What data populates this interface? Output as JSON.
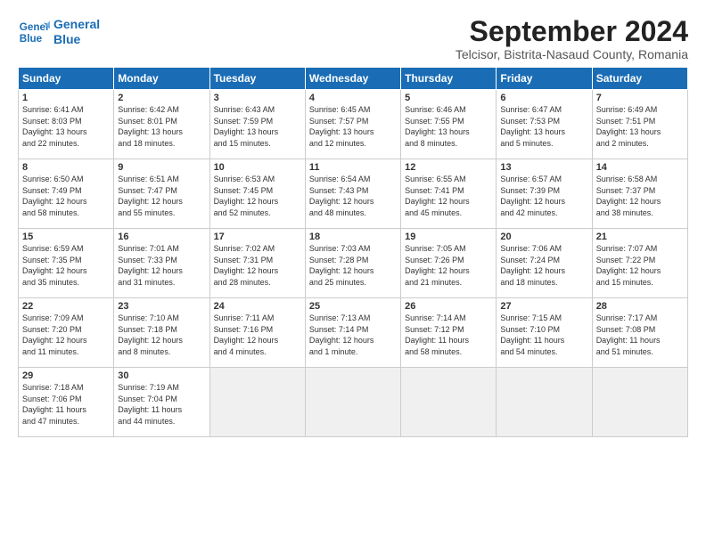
{
  "header": {
    "logo_line1": "General",
    "logo_line2": "Blue",
    "title": "September 2024",
    "subtitle": "Telcisor, Bistrita-Nasaud County, Romania"
  },
  "calendar": {
    "headers": [
      "Sunday",
      "Monday",
      "Tuesday",
      "Wednesday",
      "Thursday",
      "Friday",
      "Saturday"
    ],
    "weeks": [
      [
        {
          "day": "",
          "empty": true
        },
        {
          "day": "",
          "empty": true
        },
        {
          "day": "",
          "empty": true
        },
        {
          "day": "",
          "empty": true
        },
        {
          "day": "",
          "empty": true
        },
        {
          "day": "",
          "empty": true
        },
        {
          "day": "",
          "empty": true
        }
      ],
      [
        {
          "day": "1",
          "rise": "Sunrise: 6:41 AM",
          "set": "Sunset: 8:03 PM",
          "light": "Daylight: 13 hours",
          "light2": "and 22 minutes."
        },
        {
          "day": "2",
          "rise": "Sunrise: 6:42 AM",
          "set": "Sunset: 8:01 PM",
          "light": "Daylight: 13 hours",
          "light2": "and 18 minutes."
        },
        {
          "day": "3",
          "rise": "Sunrise: 6:43 AM",
          "set": "Sunset: 7:59 PM",
          "light": "Daylight: 13 hours",
          "light2": "and 15 minutes."
        },
        {
          "day": "4",
          "rise": "Sunrise: 6:45 AM",
          "set": "Sunset: 7:57 PM",
          "light": "Daylight: 13 hours",
          "light2": "and 12 minutes."
        },
        {
          "day": "5",
          "rise": "Sunrise: 6:46 AM",
          "set": "Sunset: 7:55 PM",
          "light": "Daylight: 13 hours",
          "light2": "and 8 minutes."
        },
        {
          "day": "6",
          "rise": "Sunrise: 6:47 AM",
          "set": "Sunset: 7:53 PM",
          "light": "Daylight: 13 hours",
          "light2": "and 5 minutes."
        },
        {
          "day": "7",
          "rise": "Sunrise: 6:49 AM",
          "set": "Sunset: 7:51 PM",
          "light": "Daylight: 13 hours",
          "light2": "and 2 minutes."
        }
      ],
      [
        {
          "day": "8",
          "rise": "Sunrise: 6:50 AM",
          "set": "Sunset: 7:49 PM",
          "light": "Daylight: 12 hours",
          "light2": "and 58 minutes."
        },
        {
          "day": "9",
          "rise": "Sunrise: 6:51 AM",
          "set": "Sunset: 7:47 PM",
          "light": "Daylight: 12 hours",
          "light2": "and 55 minutes."
        },
        {
          "day": "10",
          "rise": "Sunrise: 6:53 AM",
          "set": "Sunset: 7:45 PM",
          "light": "Daylight: 12 hours",
          "light2": "and 52 minutes."
        },
        {
          "day": "11",
          "rise": "Sunrise: 6:54 AM",
          "set": "Sunset: 7:43 PM",
          "light": "Daylight: 12 hours",
          "light2": "and 48 minutes."
        },
        {
          "day": "12",
          "rise": "Sunrise: 6:55 AM",
          "set": "Sunset: 7:41 PM",
          "light": "Daylight: 12 hours",
          "light2": "and 45 minutes."
        },
        {
          "day": "13",
          "rise": "Sunrise: 6:57 AM",
          "set": "Sunset: 7:39 PM",
          "light": "Daylight: 12 hours",
          "light2": "and 42 minutes."
        },
        {
          "day": "14",
          "rise": "Sunrise: 6:58 AM",
          "set": "Sunset: 7:37 PM",
          "light": "Daylight: 12 hours",
          "light2": "and 38 minutes."
        }
      ],
      [
        {
          "day": "15",
          "rise": "Sunrise: 6:59 AM",
          "set": "Sunset: 7:35 PM",
          "light": "Daylight: 12 hours",
          "light2": "and 35 minutes."
        },
        {
          "day": "16",
          "rise": "Sunrise: 7:01 AM",
          "set": "Sunset: 7:33 PM",
          "light": "Daylight: 12 hours",
          "light2": "and 31 minutes."
        },
        {
          "day": "17",
          "rise": "Sunrise: 7:02 AM",
          "set": "Sunset: 7:31 PM",
          "light": "Daylight: 12 hours",
          "light2": "and 28 minutes."
        },
        {
          "day": "18",
          "rise": "Sunrise: 7:03 AM",
          "set": "Sunset: 7:28 PM",
          "light": "Daylight: 12 hours",
          "light2": "and 25 minutes."
        },
        {
          "day": "19",
          "rise": "Sunrise: 7:05 AM",
          "set": "Sunset: 7:26 PM",
          "light": "Daylight: 12 hours",
          "light2": "and 21 minutes."
        },
        {
          "day": "20",
          "rise": "Sunrise: 7:06 AM",
          "set": "Sunset: 7:24 PM",
          "light": "Daylight: 12 hours",
          "light2": "and 18 minutes."
        },
        {
          "day": "21",
          "rise": "Sunrise: 7:07 AM",
          "set": "Sunset: 7:22 PM",
          "light": "Daylight: 12 hours",
          "light2": "and 15 minutes."
        }
      ],
      [
        {
          "day": "22",
          "rise": "Sunrise: 7:09 AM",
          "set": "Sunset: 7:20 PM",
          "light": "Daylight: 12 hours",
          "light2": "and 11 minutes."
        },
        {
          "day": "23",
          "rise": "Sunrise: 7:10 AM",
          "set": "Sunset: 7:18 PM",
          "light": "Daylight: 12 hours",
          "light2": "and 8 minutes."
        },
        {
          "day": "24",
          "rise": "Sunrise: 7:11 AM",
          "set": "Sunset: 7:16 PM",
          "light": "Daylight: 12 hours",
          "light2": "and 4 minutes."
        },
        {
          "day": "25",
          "rise": "Sunrise: 7:13 AM",
          "set": "Sunset: 7:14 PM",
          "light": "Daylight: 12 hours",
          "light2": "and 1 minute."
        },
        {
          "day": "26",
          "rise": "Sunrise: 7:14 AM",
          "set": "Sunset: 7:12 PM",
          "light": "Daylight: 11 hours",
          "light2": "and 58 minutes."
        },
        {
          "day": "27",
          "rise": "Sunrise: 7:15 AM",
          "set": "Sunset: 7:10 PM",
          "light": "Daylight: 11 hours",
          "light2": "and 54 minutes."
        },
        {
          "day": "28",
          "rise": "Sunrise: 7:17 AM",
          "set": "Sunset: 7:08 PM",
          "light": "Daylight: 11 hours",
          "light2": "and 51 minutes."
        }
      ],
      [
        {
          "day": "29",
          "rise": "Sunrise: 7:18 AM",
          "set": "Sunset: 7:06 PM",
          "light": "Daylight: 11 hours",
          "light2": "and 47 minutes."
        },
        {
          "day": "30",
          "rise": "Sunrise: 7:19 AM",
          "set": "Sunset: 7:04 PM",
          "light": "Daylight: 11 hours",
          "light2": "and 44 minutes."
        },
        {
          "day": "",
          "empty": true
        },
        {
          "day": "",
          "empty": true
        },
        {
          "day": "",
          "empty": true
        },
        {
          "day": "",
          "empty": true
        },
        {
          "day": "",
          "empty": true
        }
      ]
    ]
  }
}
